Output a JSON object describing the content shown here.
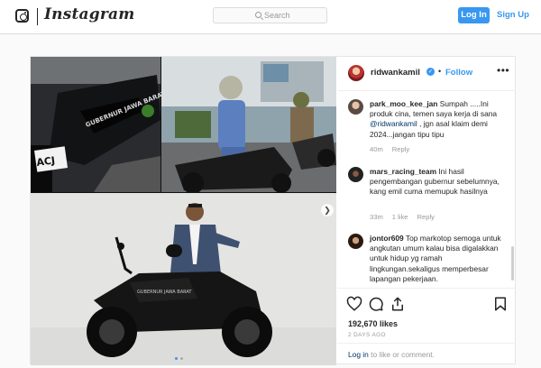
{
  "nav": {
    "brand": "Instagram",
    "search_placeholder": "Search",
    "login_label": "Log In",
    "signup_label": "Sign Up"
  },
  "post": {
    "owner": "ridwankamil",
    "follow_label": "Follow",
    "more_label": "•••",
    "bullet": "•",
    "likes": "192,670 likes",
    "time_ago": "2 DAYS AGO",
    "login_prompt": {
      "link": "Log in",
      "rest": " to like or comment."
    },
    "carousel_position": {
      "current": 1,
      "total": 2
    },
    "media_plate_text": "ACJ"
  },
  "comments": [
    {
      "user": "park_moo_kee_jan",
      "text_before": " Sumpah .....Ini produk cina, temen saya kerja di sana ",
      "mention": "@ridwankamil",
      "text_after": " , jgn asal klaim demi 2024...jangan tipu tipu",
      "time": "40m",
      "likes": "",
      "reply": "Reply"
    },
    {
      "user": "mars_racing_team",
      "text_before": " Ini hasil pengembangan gubernur sebelumnya, kang emil cuma memupuk hasilnya",
      "mention": "",
      "text_after": "",
      "time": "33m",
      "likes": "1 like",
      "reply": "Reply"
    },
    {
      "user": "jontor609",
      "text_before": " Top markotop semoga untuk angkutan umum kalau bisa digalakkan untuk hidup yg ramah lingkungan.sekaligus memperbesar lapangan pekerjaan.",
      "mention": "",
      "text_after": "",
      "time": "",
      "likes": "",
      "reply": ""
    }
  ],
  "colors": {
    "accent": "#3897f0",
    "link": "#003569",
    "muted": "#999999"
  },
  "icons": [
    "instagram-glyph-icon",
    "search-icon",
    "verified-badge-icon",
    "heart-icon",
    "comment-icon",
    "share-icon",
    "bookmark-icon",
    "chevron-right-icon"
  ]
}
